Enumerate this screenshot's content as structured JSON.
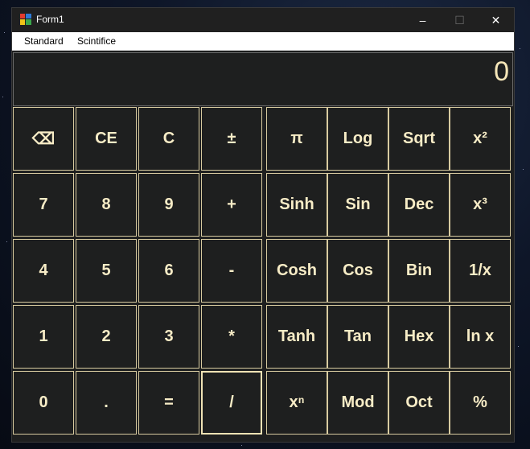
{
  "window": {
    "title": "Form1",
    "minimize": "–",
    "maximize": "☐",
    "close": "✕"
  },
  "menu": {
    "items": [
      "Standard",
      "Scintifice"
    ]
  },
  "display": {
    "value": "0"
  },
  "keypad": {
    "rows": [
      [
        "⌫",
        "CE",
        "C",
        "±"
      ],
      [
        "7",
        "8",
        "9",
        "+"
      ],
      [
        "4",
        "5",
        "6",
        "-"
      ],
      [
        "1",
        "2",
        "3",
        "*"
      ],
      [
        "0",
        ".",
        "=",
        "/"
      ]
    ]
  },
  "scientific": {
    "rows": [
      [
        "π",
        "Log",
        "Sqrt",
        "x²"
      ],
      [
        "Sinh",
        "Sin",
        "Dec",
        "x³"
      ],
      [
        "Cosh",
        "Cos",
        "Bin",
        "1/x"
      ],
      [
        "Tanh",
        "Tan",
        "Hex",
        "ln x"
      ],
      [
        "xⁿ",
        "Mod",
        "Oct",
        "%"
      ]
    ]
  }
}
